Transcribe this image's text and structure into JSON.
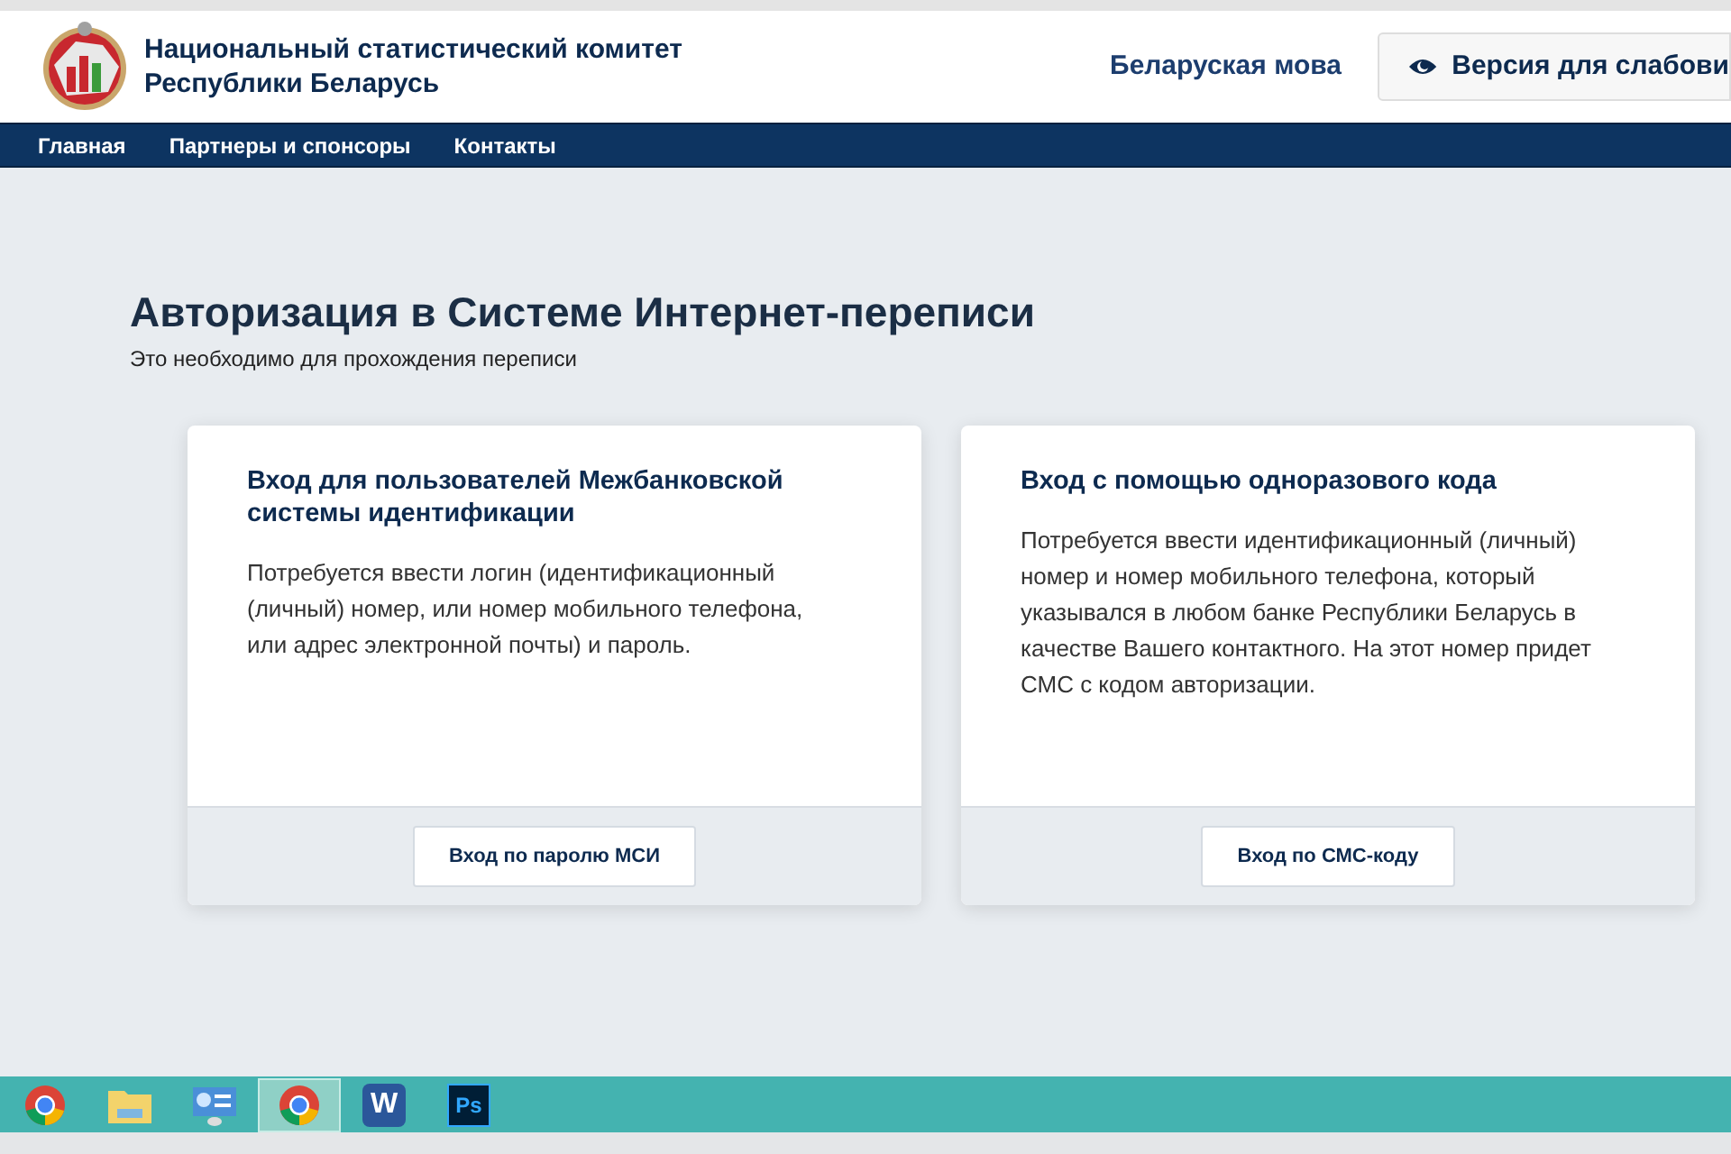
{
  "header": {
    "org_name": [
      "Национальный статистический комитет",
      "Республики Беларусь"
    ],
    "language_link": "Беларуская мова",
    "accessibility_button": "Версия для слабови"
  },
  "nav": [
    "Главная",
    "Партнеры и спонсоры",
    "Контакты"
  ],
  "page": {
    "title": "Авторизация в Системе Интернет-переписи",
    "subtitle": "Это необходимо для прохождения переписи"
  },
  "cards": [
    {
      "title": "Вход для пользователей Межбанковской системы идентификации",
      "text": "Потребуется ввести логин (идентификационный (личный) номер, или номер мобильного телефона, или адрес электронной почты) и пароль.",
      "button": "Вход по паролю МСИ"
    },
    {
      "title": "Вход с помощью одноразового кода",
      "text": "Потребуется ввести идентификационный (личный) номер и номер мобильного телефона, который указывался в любом банке Республики Беларусь в качестве Вашего контактного. На этот номер придет СМС с кодом авторизации.",
      "button": "Вход по СМС-коду"
    }
  ],
  "taskbar": [
    {
      "kind": "chrome",
      "selected": false
    },
    {
      "kind": "folder",
      "selected": false
    },
    {
      "kind": "panel",
      "selected": false
    },
    {
      "kind": "chrome",
      "selected": true
    },
    {
      "kind": "letter",
      "label": "W",
      "selected": false
    },
    {
      "kind": "ps",
      "label": "Ps",
      "selected": false
    }
  ]
}
